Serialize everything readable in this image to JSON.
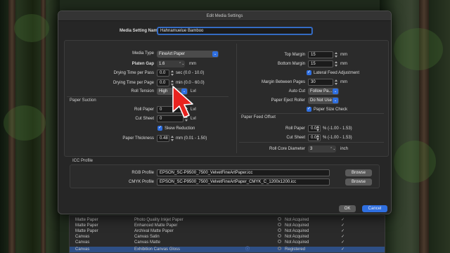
{
  "dialog": {
    "title": "Edit Media Settings",
    "media_setting_name_label": "Media Setting Name",
    "media_setting_name_value": "Hahnamuelue Bamboo"
  },
  "left": {
    "media_type_label": "Media Type",
    "media_type_value": "FineArt Paper",
    "platen_gap_label": "Platen Gap",
    "platen_gap_value": "1.6",
    "platen_gap_unit": "mm",
    "dry_pass_label": "Drying Time per Pass",
    "dry_pass_value": "0.0",
    "dry_pass_unit": "sec (0.0 - 10.0)",
    "dry_page_label": "Drying Time per Page",
    "dry_page_value": "0.0",
    "dry_page_unit": "min (0.0 - 60.0)",
    "roll_tension_label": "Roll Tension",
    "roll_tension_value": "High",
    "roll_tension_unit": "Lvl",
    "paper_suction_title": "Paper Suction",
    "roll_paper_label": "Roll Paper",
    "roll_paper_value": "0",
    "roll_paper_unit": "Lvl",
    "cut_sheet_label": "Cut Sheet",
    "cut_sheet_value": "0",
    "cut_sheet_unit": "Lvl",
    "skew_reduction_label": "Skew Reduction",
    "thickness_label": "Paper Thickness",
    "thickness_value": "0.48",
    "thickness_unit": "mm (0.01 - 1.50)"
  },
  "right": {
    "top_margin_label": "Top Margin",
    "top_margin_value": "15",
    "top_margin_unit": "mm",
    "bottom_margin_label": "Bottom Margin",
    "bottom_margin_value": "15",
    "bottom_margin_unit": "mm",
    "lateral_feed_label": "Lateral Feed Adjustment",
    "margin_between_label": "Margin Between Pages",
    "margin_between_value": "30",
    "margin_between_unit": "mm",
    "auto_cut_label": "Auto Cut",
    "auto_cut_value": "Follow Pa...",
    "eject_roller_label": "Paper Eject Roller",
    "eject_roller_value": "Do Not Use",
    "paper_size_check_label": "Paper Size Check",
    "feed_offset_title": "Paper Feed Offset",
    "offset_roll_label": "Roll Paper",
    "offset_roll_value": "0.00",
    "offset_roll_unit": "% (-1.00 - 1.53)",
    "offset_cut_label": "Cut Sheet",
    "offset_cut_value": "0.00",
    "offset_cut_unit": "% (-1.00 - 1.53)",
    "core_diameter_label": "Roll Core Diameter",
    "core_diameter_value": "3",
    "core_diameter_unit": "inch"
  },
  "icc": {
    "title": "ICC Profile",
    "rgb_label": "RGB Profile",
    "rgb_value": "EPSON_SC-P9500_7500_VelvetFineArtPaper.icc",
    "cmyk_label": "CMYK Profile",
    "cmyk_value": "EPSON_SC-P9500_7500_VelvetFineArtPaper_CMYK_C_1200x1200.icc",
    "browse_label": "Browse"
  },
  "footer": {
    "ok_label": "OK",
    "cancel_label": "Cancel"
  },
  "background_list": [
    {
      "cat": "Matte Paper",
      "name": "Photo Quality Inkjet Paper",
      "status": "Not Acquired"
    },
    {
      "cat": "Matte Paper",
      "name": "Enhanced Matte Paper",
      "status": "Not Acquired"
    },
    {
      "cat": "Matte Paper",
      "name": "Archival Matte Paper",
      "status": "Not Acquired"
    },
    {
      "cat": "Canvas",
      "name": "Canvas Satin",
      "status": "Not Acquired"
    },
    {
      "cat": "Canvas",
      "name": "Canvas Matte",
      "status": "Not Acquired"
    },
    {
      "cat": "Canvas",
      "name": "Exhibition Canvas Gloss",
      "status": "Registered"
    }
  ],
  "colors": {
    "accent": "#2f6fe0",
    "cursor": "#e8231f",
    "dialog_bg": "#262626"
  }
}
